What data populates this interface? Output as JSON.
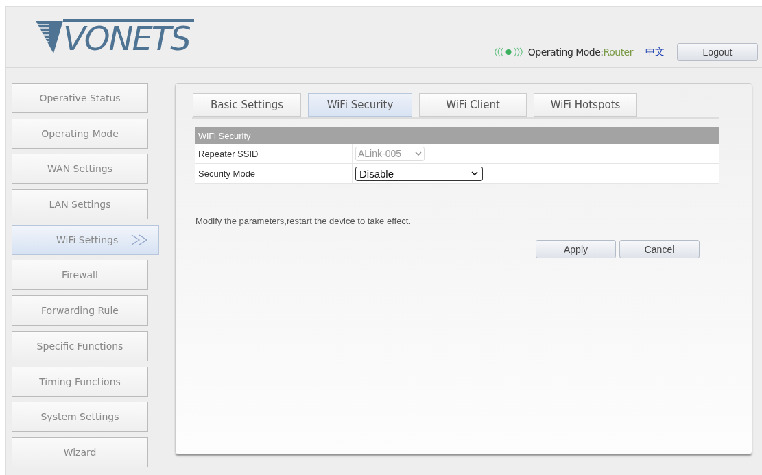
{
  "header": {
    "logo": "VONETS",
    "mode_label": "Operating Mode:",
    "mode_value": "Router",
    "language_link": "中文",
    "logout": "Logout"
  },
  "sidebar": {
    "items": [
      {
        "label": "Operative Status",
        "selected": false
      },
      {
        "label": "Operating Mode",
        "selected": false
      },
      {
        "label": "WAN Settings",
        "selected": false
      },
      {
        "label": "LAN Settings",
        "selected": false
      },
      {
        "label": "WiFi Settings",
        "selected": true
      },
      {
        "label": "Firewall",
        "selected": false
      },
      {
        "label": "Forwarding Rule",
        "selected": false
      },
      {
        "label": "Specific Functions",
        "selected": false
      },
      {
        "label": "Timing Functions",
        "selected": false
      },
      {
        "label": "System Settings",
        "selected": false
      },
      {
        "label": "Wizard",
        "selected": false
      }
    ]
  },
  "tabs": [
    {
      "label": "Basic Settings",
      "selected": false
    },
    {
      "label": "WiFi Security",
      "selected": true
    },
    {
      "label": "WiFi Client",
      "selected": false
    },
    {
      "label": "WiFi Hotspots",
      "selected": false
    }
  ],
  "form": {
    "title": "WiFi Security",
    "rows": [
      {
        "label": "Repeater SSID",
        "value": "ALink-005",
        "disabled": true
      },
      {
        "label": "Security Mode",
        "value": "Disable",
        "disabled": false
      }
    ]
  },
  "note": "Modify the parameters,restart the device to take effect.",
  "buttons": [
    "Apply",
    "Cancel"
  ]
}
